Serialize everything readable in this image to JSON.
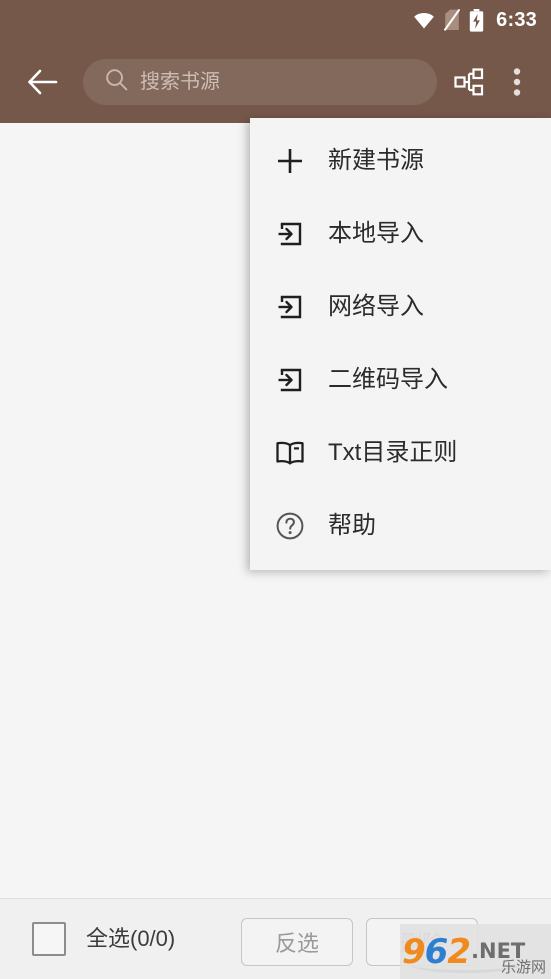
{
  "status_bar": {
    "wifi_icon": "wifi-icon",
    "sim_off_icon": "sim-card-off-icon",
    "battery_icon": "battery-charging-icon",
    "clock": "6:33",
    "background_color": "#75584a",
    "foreground_color": "#ffffff"
  },
  "app_bar": {
    "background_color": "#75584a",
    "back_icon": "arrow-left-icon",
    "search": {
      "icon": "search-icon",
      "placeholder": "搜索书源",
      "value": ""
    },
    "group_icon": "source-group-icon",
    "overflow_icon": "more-vertical-icon"
  },
  "overflow_menu": {
    "background_color": "#f4f4f4",
    "items": [
      {
        "icon": "plus-icon",
        "label": "新建书源"
      },
      {
        "icon": "import-arrow-icon",
        "label": "本地导入"
      },
      {
        "icon": "import-arrow-icon",
        "label": "网络导入"
      },
      {
        "icon": "import-arrow-icon",
        "label": "二维码导入"
      },
      {
        "icon": "open-book-icon",
        "label": "Txt目录正则"
      },
      {
        "icon": "help-circle-icon",
        "label": "帮助"
      }
    ]
  },
  "content": {
    "background_color": "#f5f5f5",
    "empty_list": ""
  },
  "bottom_bar": {
    "background_color": "#f0f0f0",
    "select_all": {
      "checkbox_icon": "checkbox-unchecked-icon",
      "label": "全选(0/0)",
      "checked": false
    },
    "invert_button": "反选",
    "delete_button": "删除"
  },
  "watermark": {
    "digit_9": "9",
    "digit_6": "6",
    "digit_2": "2",
    "net": ".NET",
    "cn_name": "乐游网"
  }
}
